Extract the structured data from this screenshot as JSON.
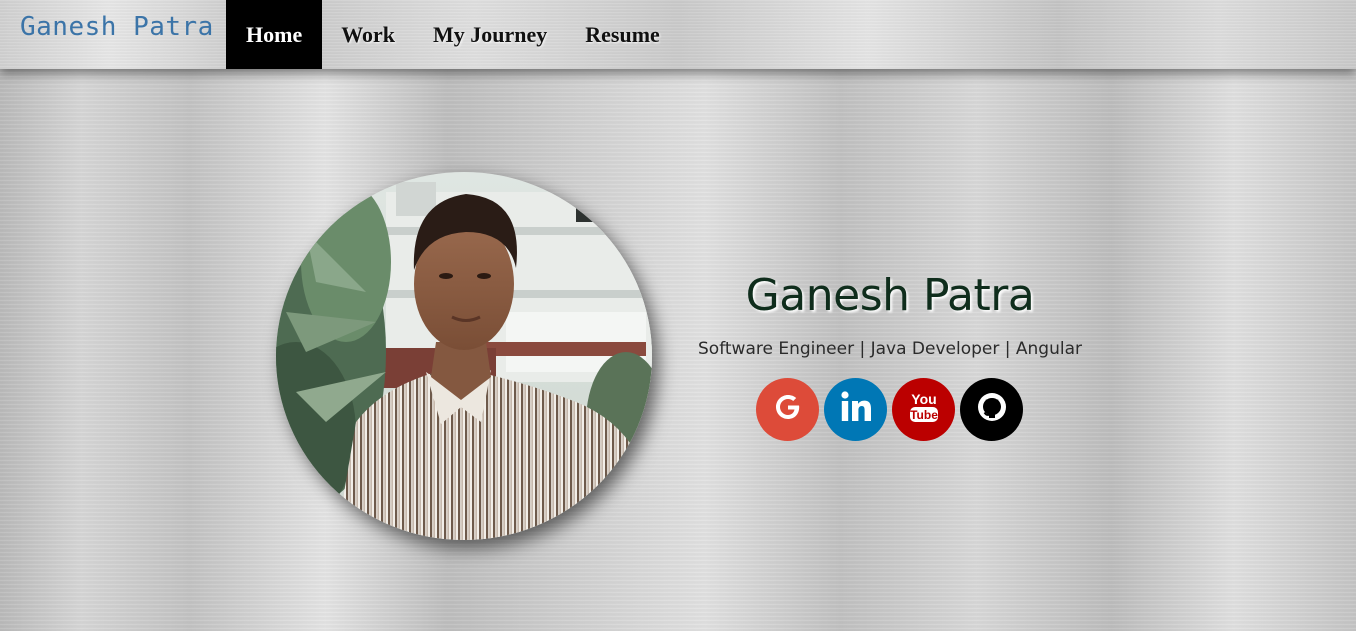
{
  "brand": {
    "name": "Ganesh Patra"
  },
  "nav": {
    "items": [
      {
        "label": "Home",
        "active": true
      },
      {
        "label": "Work",
        "active": false
      },
      {
        "label": "My Journey",
        "active": false
      },
      {
        "label": "Resume",
        "active": false
      }
    ]
  },
  "profile": {
    "photo_icon": "profile-photo",
    "name": "Ganesh Patra",
    "tagline": "Software Engineer | Java Developer | Angular"
  },
  "social": [
    {
      "icon": "google-icon",
      "color": "#dd4b39"
    },
    {
      "icon": "linkedin-icon",
      "color": "#0077b5"
    },
    {
      "icon": "youtube-icon",
      "color": "#bb0000",
      "text_top": "You",
      "text_bottom": "Tube"
    },
    {
      "icon": "github-icon",
      "color": "#000000"
    }
  ],
  "colors": {
    "brand": "#3b74a8",
    "nav_active_bg": "#000000",
    "hero_name": "#0f2d1c"
  }
}
